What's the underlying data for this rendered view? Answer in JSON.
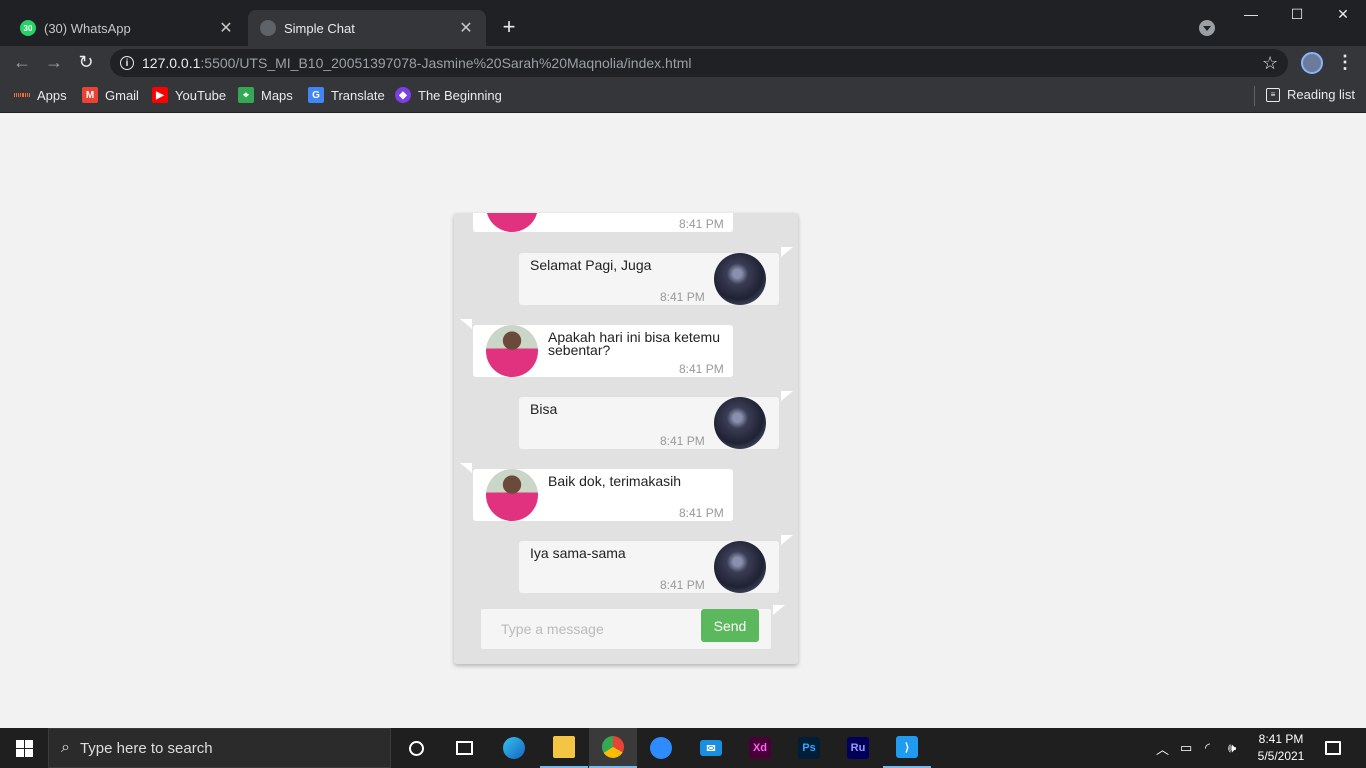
{
  "browser": {
    "tabs": [
      {
        "title": "(30) WhatsApp",
        "favicon_badge": "30",
        "active": false
      },
      {
        "title": "Simple Chat",
        "active": true
      }
    ],
    "url_host": "127.0.0.1",
    "url_rest": ":5500/UTS_MI_B10_20051397078-Jasmine%20Sarah%20Maqnolia/index.html",
    "bookmarks": [
      {
        "label": "Apps",
        "icon": "apps-grid-icon"
      },
      {
        "label": "Gmail",
        "icon": "gmail-icon",
        "color": "#ea4335"
      },
      {
        "label": "YouTube",
        "icon": "youtube-icon",
        "color": "#ff0000"
      },
      {
        "label": "Maps",
        "icon": "maps-icon",
        "color": "#34a853"
      },
      {
        "label": "Translate",
        "icon": "translate-icon",
        "color": "#4285f4"
      },
      {
        "label": "The Beginning",
        "icon": "bookmark-app-icon",
        "color": "#7b3fe4"
      }
    ],
    "reading_list": "Reading list"
  },
  "chat": {
    "messages": [
      {
        "side": "left",
        "text": "",
        "time": "8:41 PM"
      },
      {
        "side": "right",
        "text": "Selamat Pagi, Juga",
        "time": "8:41 PM"
      },
      {
        "side": "left",
        "text": "Apakah hari ini bisa ketemu sebentar?",
        "time": "8:41 PM"
      },
      {
        "side": "right",
        "text": "Bisa",
        "time": "8:41 PM"
      },
      {
        "side": "left",
        "text": "Baik dok, terimakasih",
        "time": "8:41 PM"
      },
      {
        "side": "right",
        "text": "Iya sama-sama",
        "time": "8:41 PM"
      }
    ],
    "input_placeholder": "Type a message",
    "send_label": "Send",
    "send_color": "#5cb85c"
  },
  "taskbar": {
    "search_placeholder": "Type here to search",
    "apps": [
      "cortana-icon",
      "task-view-icon",
      "edge-icon",
      "file-explorer-icon",
      "chrome-icon",
      "zoom-icon",
      "mail-icon",
      "adobe-xd-icon",
      "photoshop-icon",
      "premiere-rush-icon",
      "vscode-icon"
    ],
    "xd_label": "Xd",
    "ps_label": "Ps",
    "ru_label": "Ru",
    "time": "8:41 PM",
    "date": "5/5/2021"
  }
}
